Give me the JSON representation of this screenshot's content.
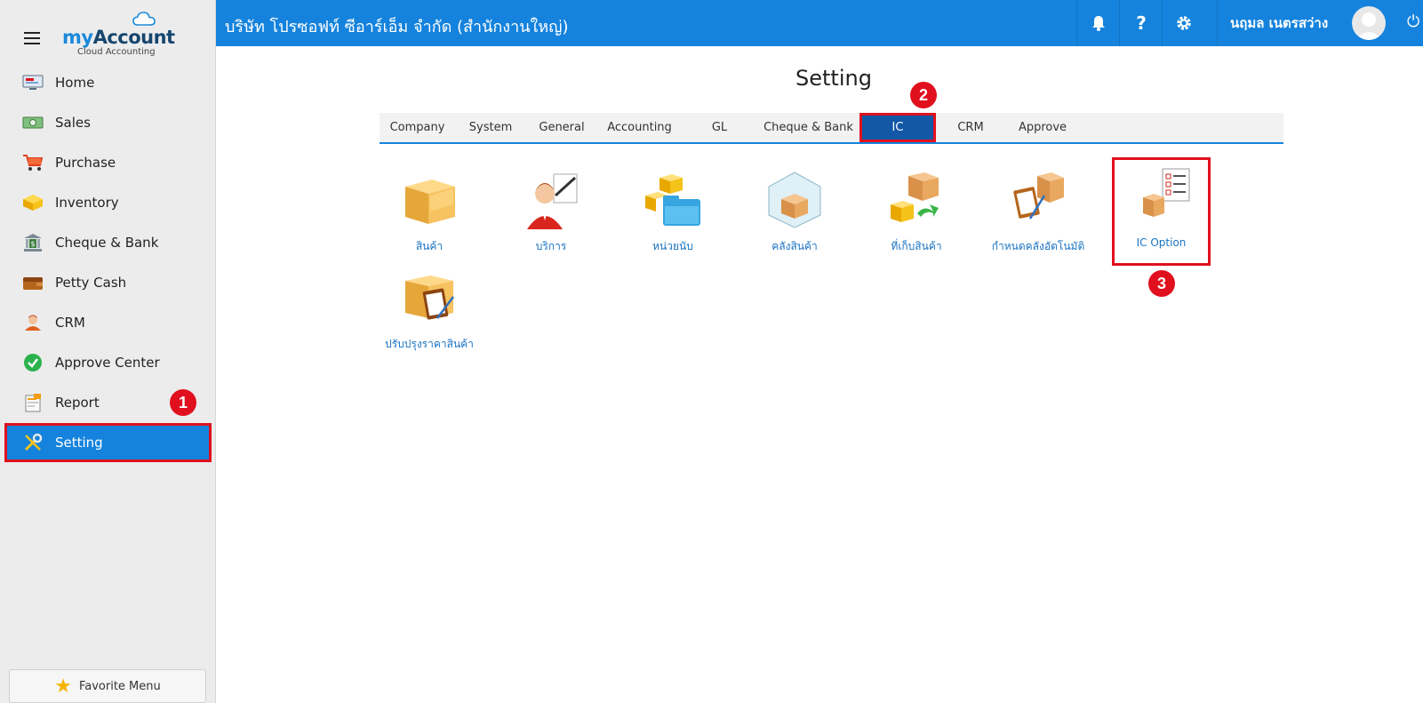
{
  "sidebar": {
    "logo_main_my": "my",
    "logo_main_account": "Account",
    "logo_sub": "Cloud Accounting",
    "items": [
      {
        "label": "Home"
      },
      {
        "label": "Sales"
      },
      {
        "label": "Purchase"
      },
      {
        "label": "Inventory"
      },
      {
        "label": "Cheque & Bank"
      },
      {
        "label": "Petty Cash"
      },
      {
        "label": "CRM"
      },
      {
        "label": "Approve Center"
      },
      {
        "label": "Report"
      },
      {
        "label": "Setting"
      }
    ],
    "favorite_label": "Favorite Menu"
  },
  "topbar": {
    "company": "บริษัท โปรซอฟท์ ซีอาร์เอ็ม จำกัด (สำนักงานใหญ่)",
    "user": "นฤมล เนตรสว่าง"
  },
  "main": {
    "title": "Setting",
    "tabs": [
      "Company",
      "System",
      "General",
      "Accounting",
      "GL",
      "Cheque & Bank",
      "IC",
      "CRM",
      "Approve"
    ],
    "active_tab": "IC",
    "tiles": [
      {
        "label": "สินค้า"
      },
      {
        "label": "บริการ"
      },
      {
        "label": "หน่วยนับ"
      },
      {
        "label": "คลังสินค้า"
      },
      {
        "label": "ที่เก็บสินค้า"
      },
      {
        "label": "กำหนดคลังอัตโนมัติ"
      },
      {
        "label": "IC Option"
      },
      {
        "label": "ปรับปรุงราคาสินค้า"
      }
    ]
  },
  "annotations": {
    "step1": "1",
    "step2": "2",
    "step3": "3"
  },
  "colors": {
    "accent": "#1583dd",
    "highlight": "#e0101e",
    "active_tab": "#1358a6"
  }
}
